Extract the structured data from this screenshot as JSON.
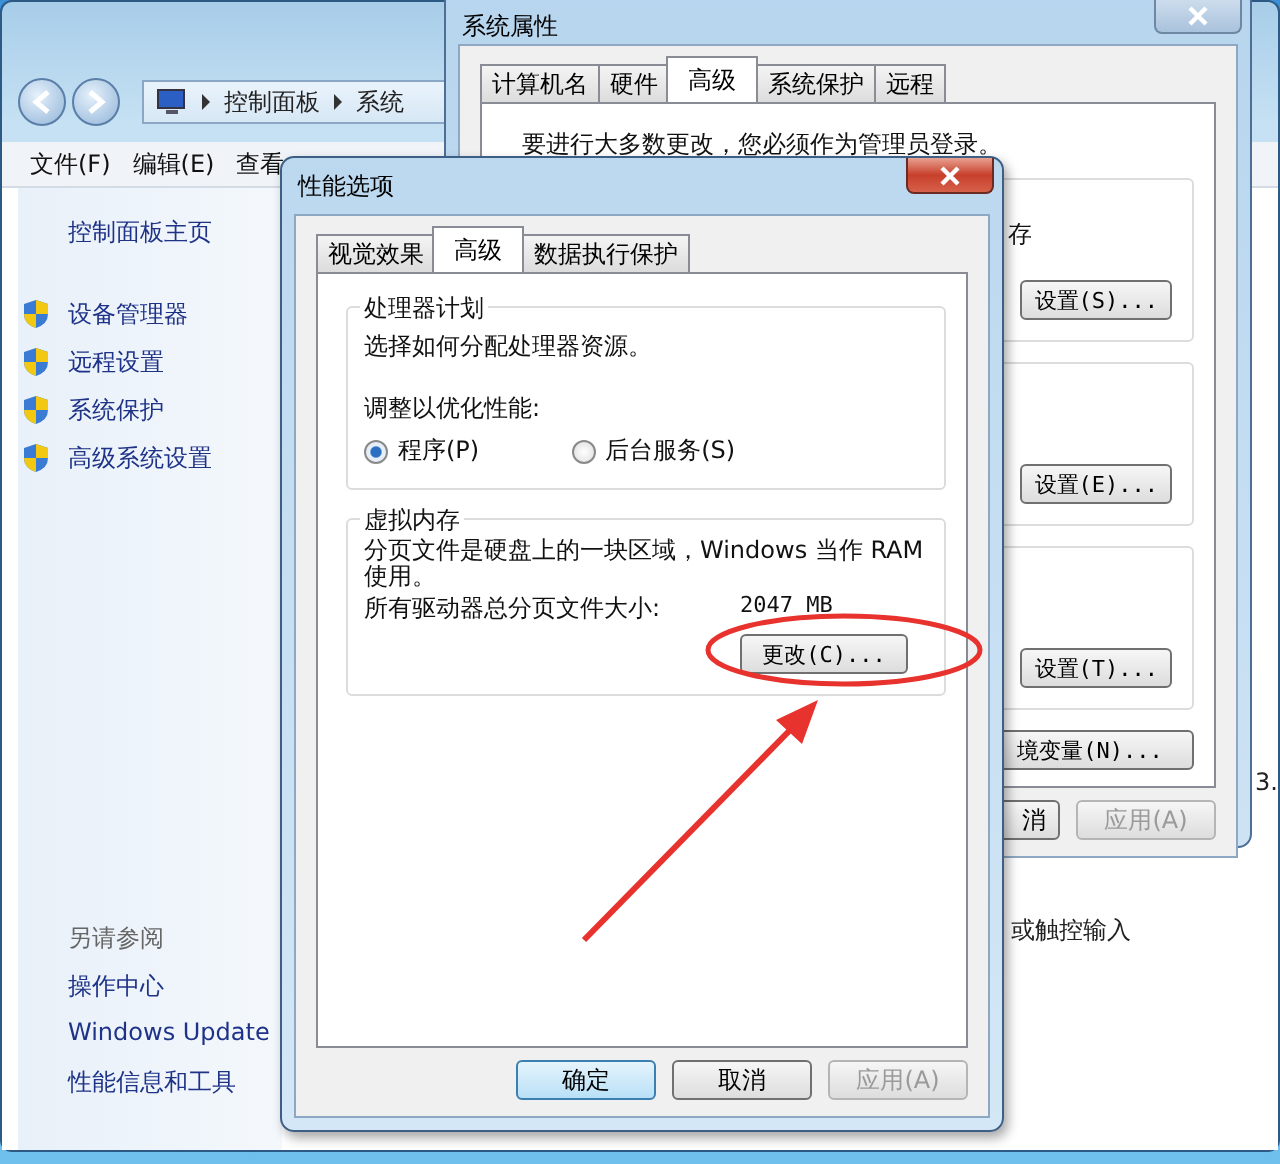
{
  "explorer": {
    "breadcrumb": [
      "控制面板",
      "系统"
    ],
    "menu": [
      "文件(F)",
      "编辑(E)",
      "查看"
    ],
    "sidebar_home": "控制面板主页",
    "tasks": [
      "设备管理器",
      "远程设置",
      "系统保护",
      "高级系统设置"
    ],
    "see_also_title": "另请参阅",
    "see_also": [
      "操作中心",
      "Windows Update",
      "性能信息和工具"
    ],
    "content_fragments": [
      "3.",
      "或触控输入"
    ]
  },
  "system_properties": {
    "title": "系统属性",
    "tabs": [
      {
        "label": "计算机名",
        "selected": false
      },
      {
        "label": "硬件",
        "selected": false
      },
      {
        "label": "高级",
        "selected": true
      },
      {
        "label": "系统保护",
        "selected": false
      },
      {
        "label": "远程",
        "selected": false
      }
    ],
    "admin_note": "要进行大多数更改，您必须作为管理员登录。",
    "section_fragment": "存",
    "setting_buttons": [
      "设置(S)...",
      "设置(E)...",
      "设置(T)..."
    ],
    "env_button": "境变量(N)...",
    "buttons": [
      {
        "label": "消",
        "disabled": false
      },
      {
        "label": "应用(A)",
        "disabled": true
      }
    ]
  },
  "performance_options": {
    "title": "性能选项",
    "tabs": [
      {
        "label": "视觉效果",
        "selected": false
      },
      {
        "label": "高级",
        "selected": true
      },
      {
        "label": "数据执行保护",
        "selected": false
      }
    ],
    "processor": {
      "title": "处理器计划",
      "description": "选择如何分配处理器资源。",
      "adjust_label": "调整以优化性能:",
      "options": [
        {
          "label": "程序(P)",
          "selected": true
        },
        {
          "label": "后台服务(S)",
          "selected": false
        }
      ]
    },
    "virtual_memory": {
      "title": "虚拟内存",
      "description": "分页文件是硬盘上的一块区域，Windows 当作 RAM 使用。",
      "total_label": "所有驱动器总分页文件大小:",
      "total_value": "2047 MB",
      "change_button": "更改(C)..."
    },
    "buttons": [
      {
        "label": "确定",
        "default": true,
        "disabled": false
      },
      {
        "label": "取消",
        "default": false,
        "disabled": false
      },
      {
        "label": "应用(A)",
        "default": false,
        "disabled": true
      }
    ]
  }
}
